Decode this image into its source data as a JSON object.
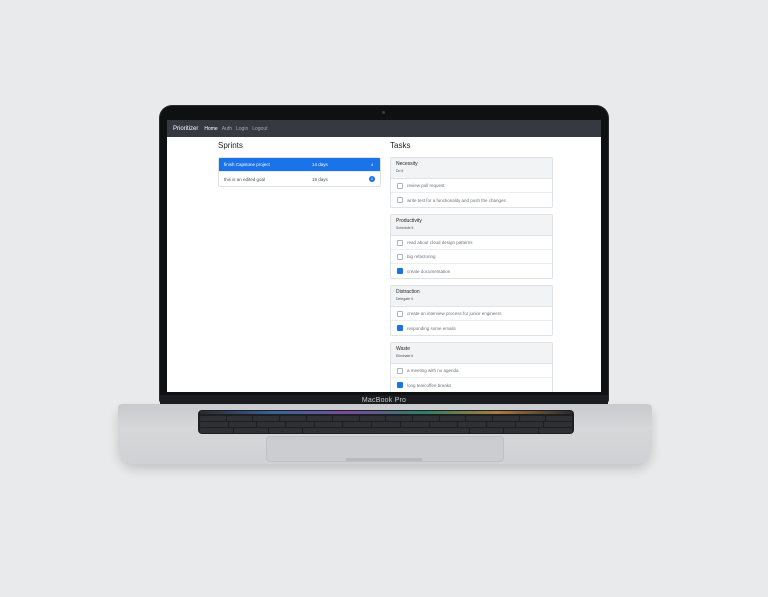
{
  "device": {
    "brand_label": "MacBook Pro"
  },
  "navbar": {
    "brand": "Prioritizer",
    "links": [
      "Home",
      "Auth",
      "Login",
      "Logout"
    ]
  },
  "sprints": {
    "heading": "Sprints",
    "items": [
      {
        "name": "finish Capstone project",
        "days": "14 days",
        "badge": "4",
        "active": true
      },
      {
        "name": "this is an edited goal",
        "days": "19 days",
        "badge": "1",
        "active": false
      }
    ]
  },
  "tasks": {
    "heading": "Tasks",
    "groups": [
      {
        "title": "Necessity",
        "subtitle": "Do it",
        "items": [
          {
            "text": "review pull request",
            "checked": false
          },
          {
            "text": "write test for a functionality and push the changes",
            "checked": false
          }
        ]
      },
      {
        "title": "Productivity",
        "subtitle": "Schedule it",
        "items": [
          {
            "text": "read about cloud design patterns",
            "checked": false
          },
          {
            "text": "big refactoring",
            "checked": false
          },
          {
            "text": "create documentation",
            "checked": true
          }
        ]
      },
      {
        "title": "Distraction",
        "subtitle": "Delegate it",
        "items": [
          {
            "text": "create an interview process for junior engineers",
            "checked": false
          },
          {
            "text": "responding some emails",
            "checked": true
          }
        ]
      },
      {
        "title": "Waste",
        "subtitle": "Eliminate it",
        "items": [
          {
            "text": "a meeting with no agenda",
            "checked": false
          },
          {
            "text": "long tea/coffee breaks",
            "checked": true
          }
        ]
      }
    ]
  },
  "colors": {
    "accent": "#1a73e8",
    "navbar": "#343a40",
    "background": "#e9eaeb"
  }
}
